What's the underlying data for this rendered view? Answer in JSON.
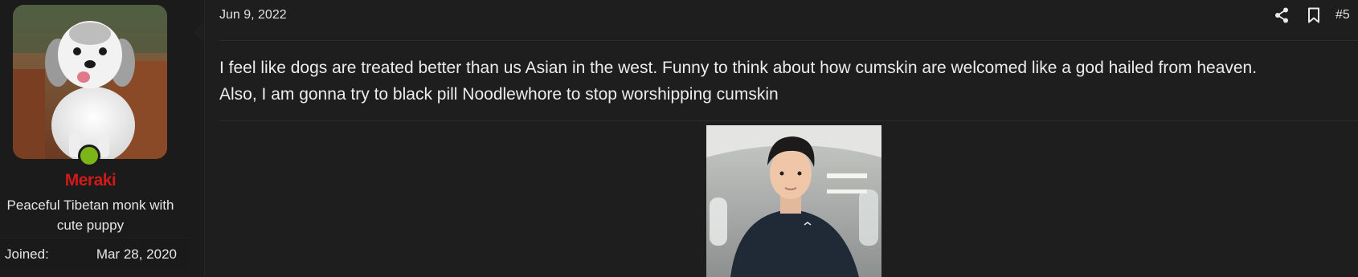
{
  "user": {
    "username": "Meraki",
    "title": "Peaceful Tibetan monk with cute puppy",
    "joined_label": "Joined:",
    "joined_value": "Mar 28, 2020",
    "online": true
  },
  "post": {
    "date": "Jun 9, 2022",
    "number": "#5",
    "lines": [
      "I feel like dogs are treated better than us Asian in the west. Funny to think about how cumskin are welcomed like a god hailed from heaven.",
      "Also, I am gonna try to black pill Noodlewhore to stop worshipping cumskin"
    ],
    "icons": {
      "share": "share-icon",
      "bookmark": "bookmark-icon"
    }
  },
  "colors": {
    "background": "#1e1e1e",
    "sidebar": "#1b1b1b",
    "username": "#d01a1a",
    "online": "#7cb518",
    "text": "#ececec"
  }
}
